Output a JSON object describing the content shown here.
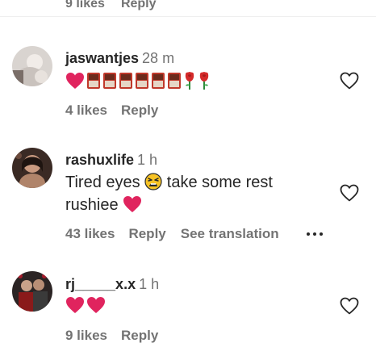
{
  "top_partial": {
    "likes": "9 likes",
    "reply": "Reply"
  },
  "comments": [
    {
      "username": "jaswantjes",
      "time": "28 m",
      "emojis": [
        "red-heart",
        "chocolate-bar",
        "chocolate-bar",
        "chocolate-bar",
        "chocolate-bar",
        "chocolate-bar",
        "chocolate-bar",
        "rose",
        "rose"
      ],
      "likes": "4 likes",
      "reply": "Reply"
    },
    {
      "username": "rashuxlife",
      "time": "1 h",
      "text_line1": "Tired eyes",
      "text_line1_b": "take some rest",
      "text_line2": "rushiee",
      "likes": "43 likes",
      "reply": "Reply",
      "translate": "See translation"
    },
    {
      "username": "rj_____x.x",
      "time": "1 h",
      "emojis": [
        "red-heart",
        "red-heart"
      ],
      "likes": "9 likes",
      "reply": "Reply"
    }
  ],
  "colors": {
    "text": "#262626",
    "secondary": "#737373",
    "heart_red": "#e0245e",
    "chocolate": "#8b2a1a"
  }
}
